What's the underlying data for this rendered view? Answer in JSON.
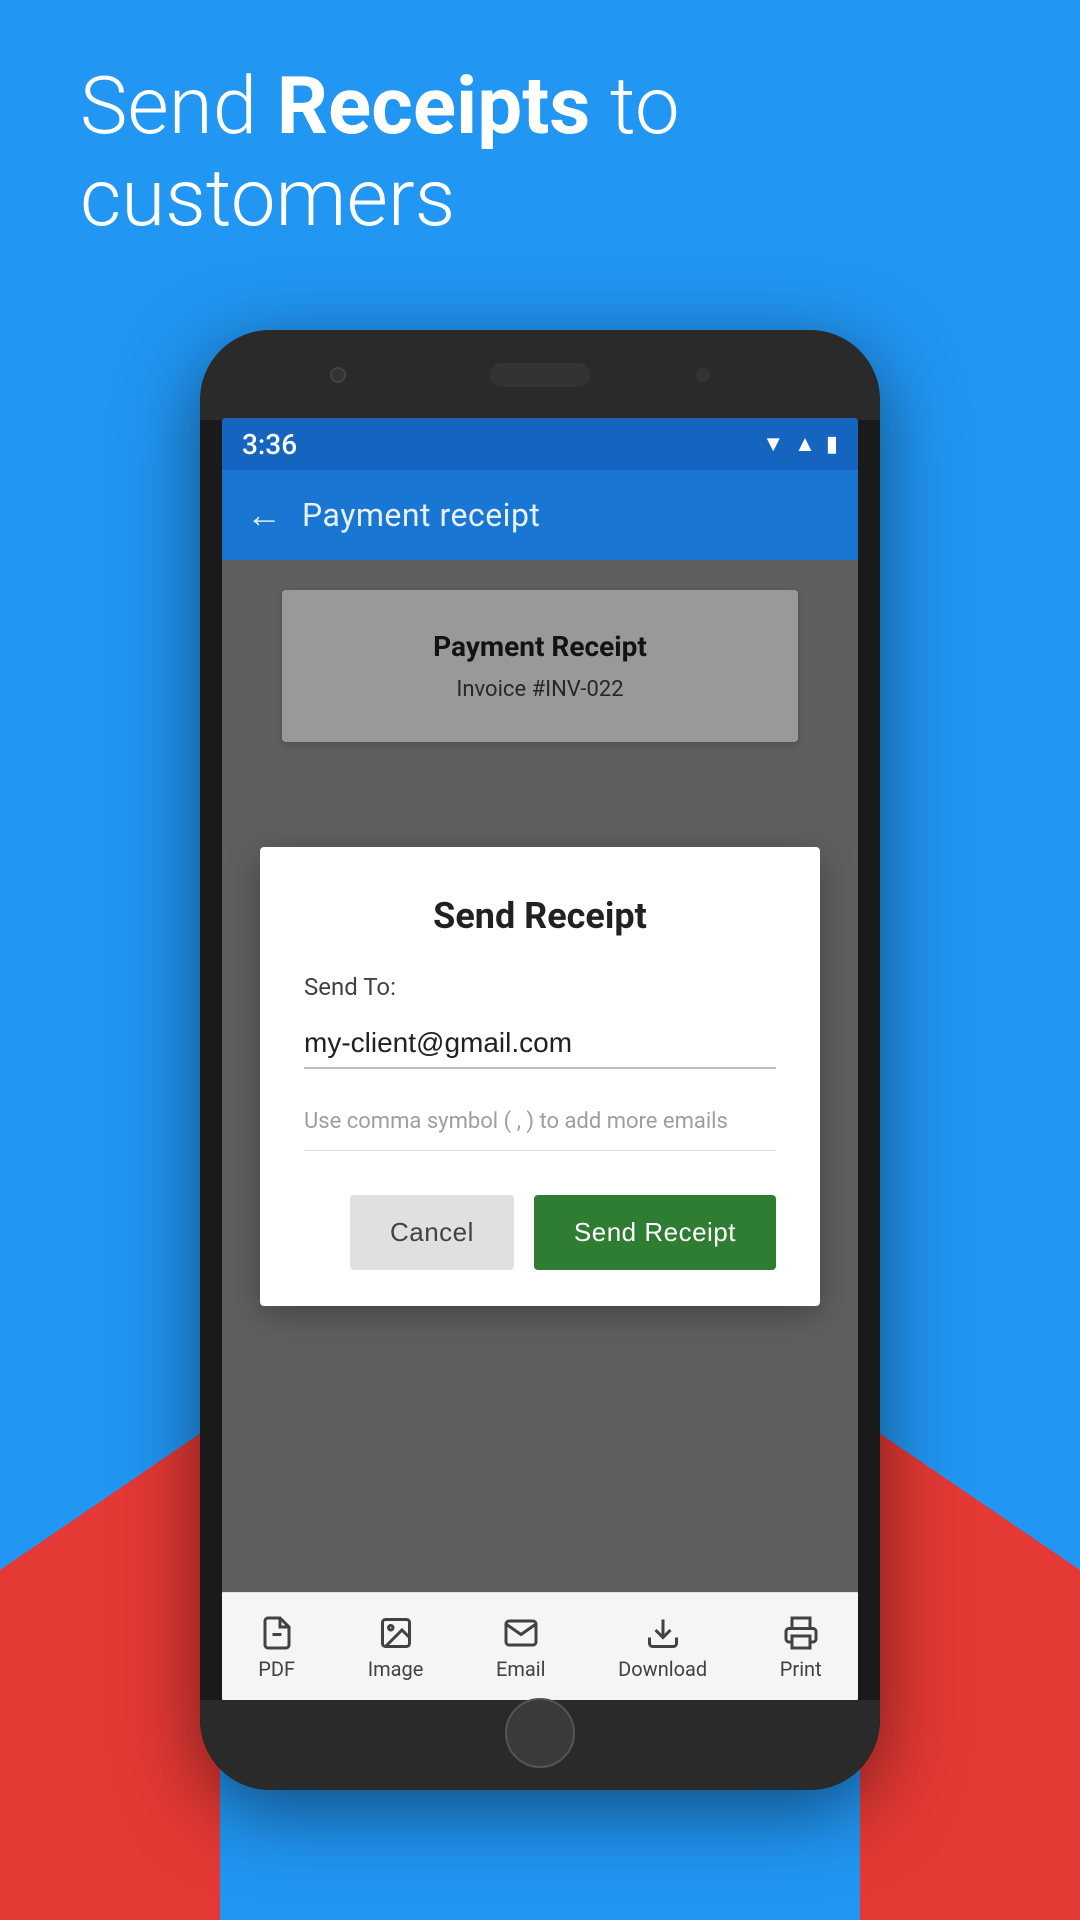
{
  "hero": {
    "line1": "Send ",
    "line1_bold": "Receipts",
    "line2": " to",
    "line3": "customers"
  },
  "status_bar": {
    "time": "3:36"
  },
  "app_bar": {
    "title": "Payment receipt",
    "back_label": "←"
  },
  "document": {
    "title": "Payment Receipt",
    "invoice": "Invoice #INV-022"
  },
  "dialog": {
    "title": "Send Receipt",
    "send_to_label": "Send To:",
    "email_value": "my-client@gmail.com",
    "email_hint": "Use comma symbol ( , ) to add more emails",
    "cancel_label": "Cancel",
    "send_label": "Send Receipt"
  },
  "bottom_nav": {
    "items": [
      {
        "label": "PDF",
        "icon": "pdf"
      },
      {
        "label": "Image",
        "icon": "image"
      },
      {
        "label": "Email",
        "icon": "email"
      },
      {
        "label": "Download",
        "icon": "download"
      },
      {
        "label": "Print",
        "icon": "print"
      }
    ]
  },
  "colors": {
    "blue": "#2196F3",
    "dark_blue": "#1976D2",
    "red": "#E53935",
    "green": "#2E7D32"
  }
}
